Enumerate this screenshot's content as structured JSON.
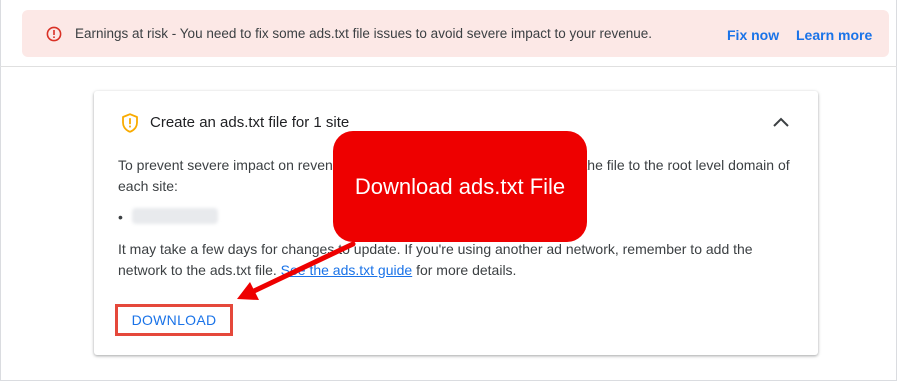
{
  "alert": {
    "message": "Earnings at risk - You need to fix some ads.txt file issues to avoid severe impact to your revenue.",
    "fix_now": "Fix now",
    "learn_more": "Learn more",
    "icon": "error-outline-icon",
    "color": "#d93025"
  },
  "card": {
    "title": "Create an ads.txt file for 1 site",
    "icon": "shield-warning-icon",
    "description": "To prevent severe impact on revenue, download the ads.txt file and upload the file to the root level domain of each site:",
    "bullet": "•",
    "note_before": "It may take a few days for changes to update. If you're using another ad network, remember to add the network to the ads.txt file.",
    "note_link": "See the ads.txt guide",
    "note_after": "for more details.",
    "download_label": "DOWNLOAD"
  },
  "annotation": {
    "callout_text": "Download ads.txt File",
    "color": "#ee0000"
  },
  "colors": {
    "link": "#1a73e8",
    "alert_bg": "#fce8e6",
    "warning": "#f9ab00"
  }
}
